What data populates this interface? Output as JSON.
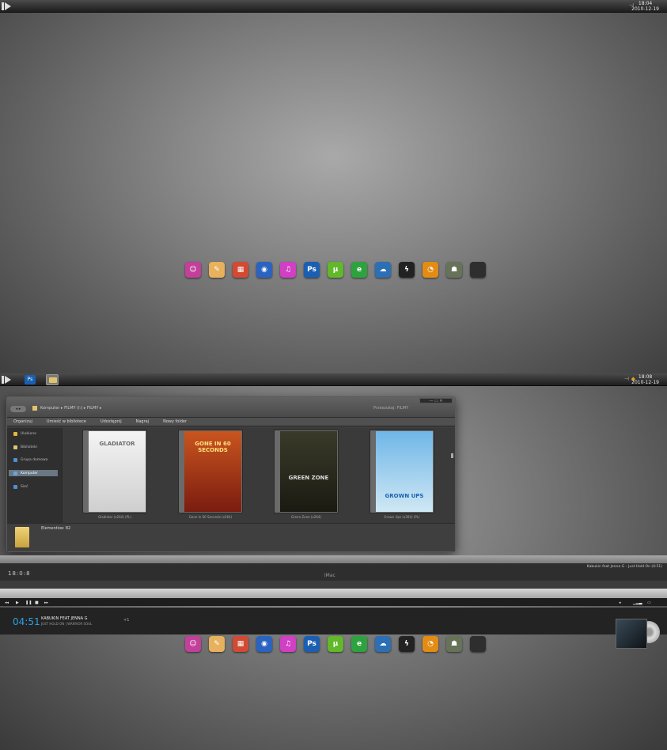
{
  "top_screen": {
    "clock": {
      "time": "18:04",
      "date": "2010-12-19"
    },
    "tray_icon": "speaker-icon"
  },
  "bottom_screen": {
    "clock": {
      "time": "18:08",
      "date": "2010-12-19"
    },
    "taskbar": [
      "photoshop-icon",
      "folder-icon"
    ],
    "explorer": {
      "breadcrumb": "Komputer ▸ FILMY (I:) ▸ FILMY ▸",
      "search_placeholder": "Przeszukaj: FILMY",
      "window_buttons": "— ▭ ✕",
      "toolbar": [
        "Organizuj",
        "Umieść w bibliotece",
        "Udostępnij",
        "Nagraj",
        "Nowy folder"
      ],
      "sidebar": [
        {
          "label": "Ulubione",
          "icon": "star-icon",
          "color": "#e8b63a"
        },
        {
          "label": "Biblioteki",
          "icon": "library-icon",
          "color": "#d8c67a"
        },
        {
          "label": "Grupa domowa",
          "icon": "homegroup-icon",
          "color": "#4e8fd2"
        },
        {
          "label": "Komputer",
          "icon": "computer-icon",
          "color": "#6aa3d8"
        },
        {
          "label": "Sieć",
          "icon": "network-icon",
          "color": "#4e8fd2"
        }
      ],
      "items": [
        {
          "title": "GLADIATOR",
          "caption": "Gladiator (x264) (PL)"
        },
        {
          "title": "GONE IN 60 SECONDS",
          "caption": "Gone In 60 Seconds (x264)"
        },
        {
          "title": "GREEN ZONE",
          "caption": "Green Zone (x264)"
        },
        {
          "title": "GROWN UPS",
          "caption": "Grown Ups (x264) (PL)"
        }
      ],
      "status": "Elementów: 82"
    },
    "player": {
      "time": "18:0:8",
      "device": "iMac",
      "track": "Kabukin feat Jenna G – Just Hold On (4:51)"
    },
    "now_playing": {
      "time": "04:51",
      "artist": "KABUKIN FEAT JENNA G",
      "album": "JUST HOLD ON  |  WARRIOR SOUL",
      "volume": "+1"
    }
  },
  "dock": [
    {
      "name": "messenger-icon",
      "bg": "#c23f9a",
      "glyph": "☺"
    },
    {
      "name": "notepad-icon",
      "bg": "#e7b15d",
      "glyph": "✎"
    },
    {
      "name": "photos-icon",
      "bg": "#d24a33",
      "glyph": "▦"
    },
    {
      "name": "firefox-icon",
      "bg": "#2b64c0",
      "glyph": "◉"
    },
    {
      "name": "itunes-icon",
      "bg": "#d03fc4",
      "glyph": "♫"
    },
    {
      "name": "photoshop-icon",
      "bg": "#1b5fb2",
      "glyph": "Ps"
    },
    {
      "name": "utorrent-icon",
      "bg": "#62b72b",
      "glyph": "µ"
    },
    {
      "name": "browser-icon",
      "bg": "#2da23e",
      "glyph": "e"
    },
    {
      "name": "chat-icon",
      "bg": "#2c6fb5",
      "glyph": "☁"
    },
    {
      "name": "winamp-icon",
      "bg": "#222222",
      "glyph": "ϟ"
    },
    {
      "name": "rss-icon",
      "bg": "#e38c14",
      "glyph": "◔"
    },
    {
      "name": "game-icon",
      "bg": "#667359",
      "glyph": "☗"
    },
    {
      "name": "blank-icon",
      "bg": "#2e2e2e",
      "glyph": ""
    }
  ]
}
